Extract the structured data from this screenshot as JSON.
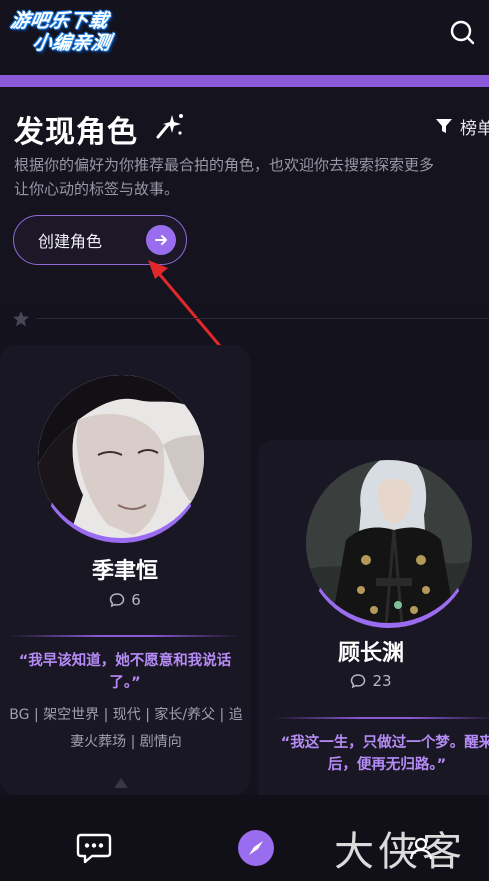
{
  "header": {
    "logo_line1": "游吧乐下载",
    "logo_line2": "小编亲测",
    "search_icon": "search-icon"
  },
  "hero": {
    "title": "发现角色",
    "rank_label": "榜单",
    "subtitle": "根据你的偏好为你推荐最合拍的角色，也欢迎你去搜索探索更多让你心动的标签与故事。",
    "create_button": "创建角色"
  },
  "cards": [
    {
      "name": "季聿恒",
      "count": "6",
      "quote": "“我早该知道，她不愿意和我说话了。”",
      "tags": "BG | 架空世界 | 现代 | 家长/养父 | 追妻火葬场 | 剧情向"
    },
    {
      "name": "顾长渊",
      "count": "23",
      "quote": "“我这一生，只做过一个梦。醒来后，便再无归路。”"
    }
  ],
  "watermark": "大侠客",
  "colors": {
    "accent": "#9a6cf0",
    "accent_bar": "#8a5ad9",
    "background": "#14121c",
    "quote": "#b58cf5",
    "annotation_arrow": "#e0282a"
  }
}
